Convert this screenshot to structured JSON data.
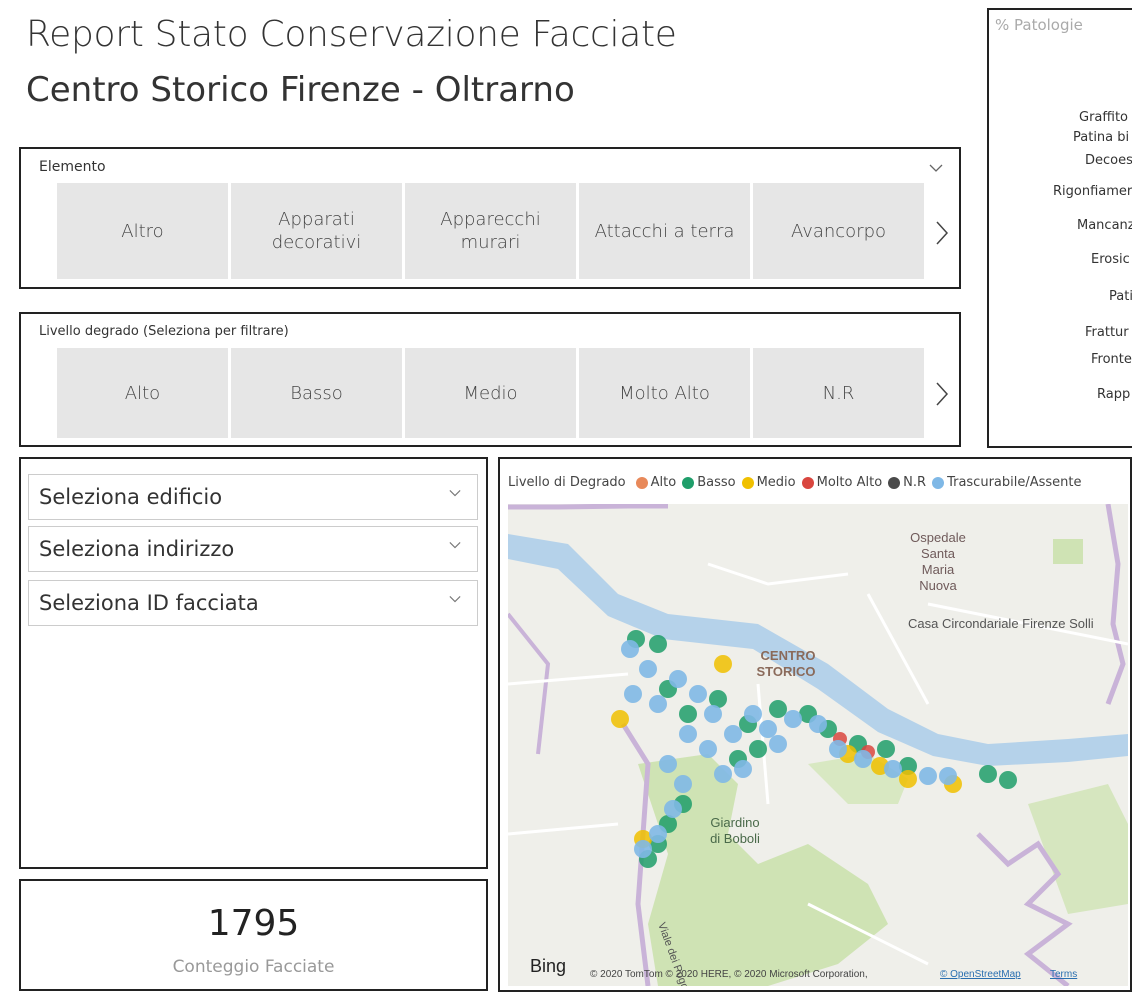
{
  "header": {
    "title": "Report Stato Conservazione Facciate",
    "subtitle": "Centro Storico Firenze - Oltrarno"
  },
  "slicer_elemento": {
    "label": "Elemento",
    "tiles": [
      "Altro",
      "Apparati\ndecorativi",
      "Apparecchi\nmurari",
      "Attacchi a terra",
      "Avancorpo"
    ]
  },
  "slicer_livello": {
    "label": "Livello degrado (Seleziona per filtrare)",
    "tiles": [
      "Alto",
      "Basso",
      "Medio",
      "Molto Alto",
      "N.R"
    ]
  },
  "filters": {
    "edificio": "Seleziona edificio",
    "indirizzo": "Seleziona indirizzo",
    "id_facciata": "Seleziona ID facciata"
  },
  "card": {
    "value": "1795",
    "label": "Conteggio Facciate"
  },
  "map": {
    "legend_title": "Livello di Degrado",
    "legend": [
      {
        "name": "Alto",
        "color": "#e8895a"
      },
      {
        "name": "Basso",
        "color": "#1f9e6a"
      },
      {
        "name": "Medio",
        "color": "#f0c000"
      },
      {
        "name": "Molto Alto",
        "color": "#d9463f"
      },
      {
        "name": "N.R",
        "color": "#4a4a4a"
      },
      {
        "name": "Trascurabile/Assente",
        "color": "#7fb8e6"
      }
    ],
    "labels": {
      "ospedale": [
        "Ospedale",
        "Santa",
        "Maria",
        "Nuova"
      ],
      "casa": "Casa Circondariale Firenze Solli",
      "centro": [
        "CENTRO",
        "STORICO"
      ],
      "giardino": [
        "Giardino",
        "di Boboli"
      ],
      "viale": "Viale dei Poggi",
      "bing": "Bing",
      "copyright": "© 2020 TomTom © 2020 HERE, © 2020 Microsoft Corporation,",
      "osm": "© OpenStreetMap",
      "terms": "Terms"
    }
  },
  "patologie": {
    "title": "% Patologie",
    "items": [
      "Graffito",
      "Patina bi",
      "Decoes",
      "Rigonfiamer",
      "Mancanz",
      "Erosic",
      "Pati",
      "Frattur",
      "Fronte",
      "Rapp"
    ]
  }
}
